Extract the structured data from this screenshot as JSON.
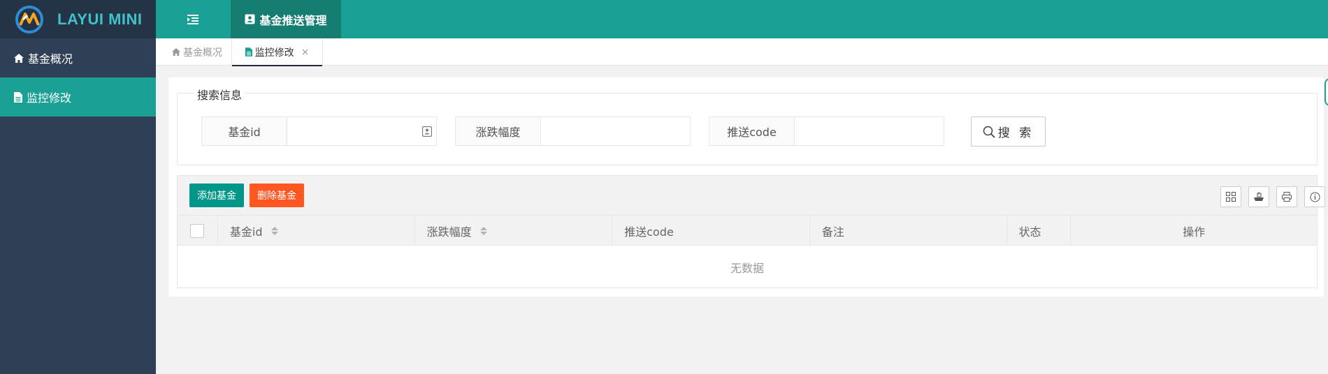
{
  "app": {
    "logo_text": "LAYUI MINI"
  },
  "header": {
    "menu_label": "基金推送管理"
  },
  "sidebar": {
    "items": [
      {
        "label": "基金概况",
        "icon": "home-icon",
        "active": false
      },
      {
        "label": "监控修改",
        "icon": "file-icon",
        "active": true
      }
    ]
  },
  "tabs": {
    "home_label": "基金概况",
    "current_label": "监控修改",
    "close_glyph": "×"
  },
  "search": {
    "legend": "搜索信息",
    "fields": [
      {
        "label": "基金id",
        "value": "",
        "placeholder": ""
      },
      {
        "label": "涨跌幅度",
        "value": "",
        "placeholder": ""
      },
      {
        "label": "推送code",
        "value": "",
        "placeholder": ""
      }
    ],
    "button_label": "搜 索"
  },
  "toolbar": {
    "add_label": "添加基金",
    "delete_label": "删除基金",
    "tool_icons": [
      "columns-icon",
      "export-icon",
      "print-icon",
      "info-icon"
    ]
  },
  "table": {
    "columns": [
      "基金id",
      "涨跌幅度",
      "推送code",
      "备注",
      "状态",
      "操作"
    ],
    "empty_text": "无数据"
  },
  "colors": {
    "primary": "#1aa094",
    "sidebar": "#2f4056",
    "logo_bg": "#243346",
    "danger": "#ff5722",
    "add_button": "#009688"
  }
}
